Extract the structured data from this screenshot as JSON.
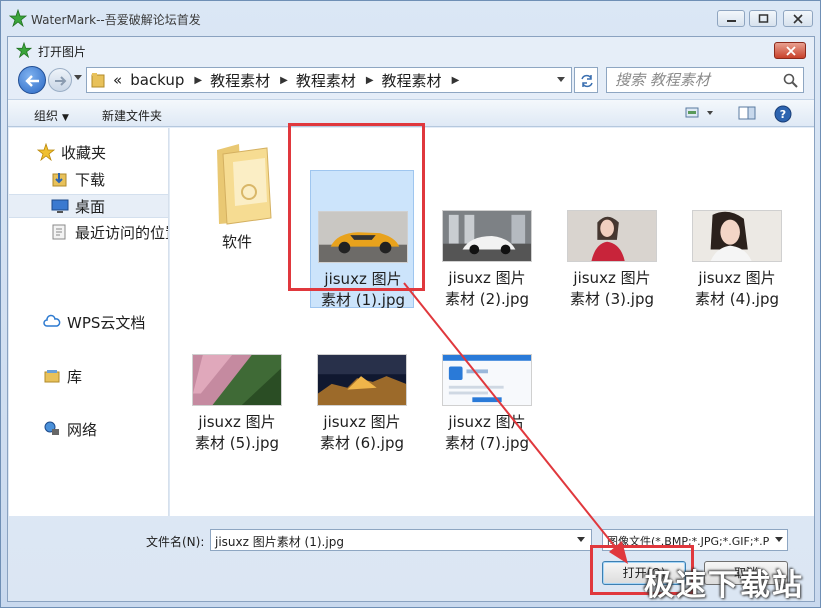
{
  "app": {
    "title": "WaterMark--吾爱破解论坛首发"
  },
  "dialog": {
    "title": "打开图片",
    "address": {
      "overflow": "«",
      "crumbs": [
        "backup",
        "教程素材",
        "教程素材",
        "教程素材"
      ]
    },
    "search_placeholder": "搜索 教程素材",
    "toolbar": {
      "organize": "组织",
      "new_folder": "新建文件夹"
    },
    "sidebar": {
      "items": [
        {
          "label": "收藏夹",
          "icon": "star-icon"
        },
        {
          "label": "下载",
          "icon": "download-folder-icon"
        },
        {
          "label": "桌面",
          "icon": "desktop-icon",
          "selected": true
        },
        {
          "label": "最近访问的位置",
          "icon": "recent-places-icon"
        },
        {
          "label": "WPS云文档",
          "icon": "cloud-icon"
        },
        {
          "label": "库",
          "icon": "library-icon"
        },
        {
          "label": "网络",
          "icon": "network-icon"
        }
      ]
    },
    "files": [
      {
        "name": "软件",
        "kind": "folder"
      },
      {
        "name": "jisuxz 图片\n素材 (1).jpg",
        "kind": "image",
        "selected": true
      },
      {
        "name": "jisuxz 图片\n素材 (2).jpg",
        "kind": "image"
      },
      {
        "name": "jisuxz 图片\n素材 (3).jpg",
        "kind": "image"
      },
      {
        "name": "jisuxz 图片\n素材 (4).jpg",
        "kind": "image"
      },
      {
        "name": "jisuxz 图片\n素材 (5).jpg",
        "kind": "image"
      },
      {
        "name": "jisuxz 图片\n素材 (6).jpg",
        "kind": "image"
      },
      {
        "name": "jisuxz 图片\n素材 (7).jpg",
        "kind": "image"
      }
    ],
    "footer": {
      "filename_label": "文件名(N):",
      "filename_value": "jisuxz 图片素材 (1).jpg",
      "filetype_value": "图像文件(*.BMP;*.JPG;*.GIF;*.P",
      "open_button": "打开(O)",
      "cancel_button": "取消"
    }
  },
  "watermark": "极速下载站",
  "colors": {
    "highlight": "#e0383d",
    "selection": "#cce4fb"
  }
}
